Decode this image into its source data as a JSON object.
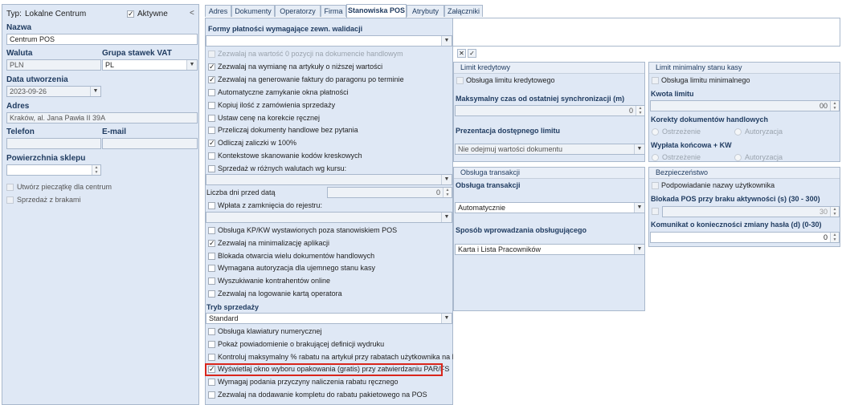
{
  "left": {
    "type_label": "Typ:",
    "type_value": "Lokalne Centrum",
    "active_label": "Aktywne",
    "active_checked": true,
    "collapse": "<",
    "name_label": "Nazwa",
    "name_value": "Centrum POS",
    "currency_label": "Waluta",
    "currency_value": "PLN",
    "vat_label": "Grupa stawek VAT",
    "vat_value": "PL",
    "created_label": "Data utworzenia",
    "created_value": "2023-09-26",
    "address_label": "Adres",
    "address_value": "Kraków, al. Jana Pawła II 39A",
    "phone_label": "Telefon",
    "email_label": "E-mail",
    "area_label": "Powierzchnia sklepu",
    "stamp_label": "Utwórz pieczątkę dla centrum",
    "barcode_label": "Sprzedaż z brakami"
  },
  "tabs": [
    "Adres",
    "Dokumenty",
    "Operatorzy",
    "Firma",
    "Stanowiska POS",
    "Atrybuty",
    "Załączniki"
  ],
  "active_tab": "Stanowiska POS",
  "mid": {
    "payment_title": "Formy płatności wymagające zewn. walidacji",
    "options_a": [
      {
        "label": "Zezwalaj na wartość 0 pozycji na dokumencie handlowym",
        "checked": false,
        "disabled": true
      },
      {
        "label": "Zezwalaj na wymianę na artykuły o niższej wartości",
        "checked": true,
        "disabled": false
      },
      {
        "label": "Zezwalaj na generowanie faktury do paragonu po terminie",
        "checked": true,
        "disabled": false
      },
      {
        "label": "Automatyczne zamykanie okna płatności",
        "checked": false,
        "disabled": false
      },
      {
        "label": "Kopiuj ilość z zamówienia sprzedaży",
        "checked": false,
        "disabled": false
      },
      {
        "label": "Ustaw cenę na korekcie ręcznej",
        "checked": false,
        "disabled": false
      },
      {
        "label": "Przeliczaj dokumenty handlowe bez pytania",
        "checked": false,
        "disabled": false
      },
      {
        "label": "Odliczaj zaliczki w 100%",
        "checked": true,
        "disabled": false
      },
      {
        "label": "Kontekstowe skanowanie kodów kreskowych",
        "checked": false,
        "disabled": false
      },
      {
        "label": "Sprzedaż w różnych walutach wg kursu:",
        "checked": false,
        "disabled": false
      }
    ],
    "days_label": "Liczba dni przed datą",
    "days_value": "0",
    "deposit_label": "Wpłata z zamknięcia do rejestru:",
    "options_b": [
      {
        "label": "Obsługa KP/KW wystawionych poza stanowiskiem POS",
        "checked": false
      },
      {
        "label": "Zezwalaj na minimalizację aplikacji",
        "checked": true
      },
      {
        "label": "Blokada otwarcia wielu dokumentów handlowych",
        "checked": false
      },
      {
        "label": "Wymagana autoryzacja dla ujemnego stanu kasy",
        "checked": false
      },
      {
        "label": "Wyszukiwanie kontrahentów online",
        "checked": false
      },
      {
        "label": "Zezwalaj na logowanie kartą operatora",
        "checked": false
      }
    ],
    "sale_mode_label": "Tryb sprzedaży",
    "sale_mode_value": "Standard",
    "options_c": [
      {
        "label": "Obsługa klawiatury numerycznej",
        "checked": false
      },
      {
        "label": "Pokaż powiadomienie o brakującej definicji wydruku",
        "checked": false
      },
      {
        "label": "Kontroluj maksymalny % rabatu na artykuł przy rabatach użytkownika na POS",
        "checked": false
      },
      {
        "label": "Wyświetlaj okno wyboru opakowania (gratis) przy zatwierdzaniu PAR/FS",
        "checked": true
      },
      {
        "label": "Wymagaj podania przyczyny naliczenia rabatu ręcznego",
        "checked": false
      },
      {
        "label": "Zezwalaj na dodawanie kompletu do rabatu pakietowego na POS",
        "checked": false
      }
    ]
  },
  "right": {
    "clear_btn": "✕",
    "ok_btn": "✓",
    "credit": {
      "title": "Limit kredytowy",
      "handle_label": "Obsługa limitu kredytowego",
      "maxtime_label": "Maksymalny czas od ostatniej synchronizacji (m)",
      "maxtime_value": "0",
      "presentation_label": "Prezentacja dostępnego limitu",
      "presentation_value": "Nie odejmuj wartości dokumentu"
    },
    "minstock": {
      "title": "Limit minimalny stanu kasy",
      "handle_label": "Obsługa limitu minimalnego",
      "amount_label": "Kwota limitu",
      "amount_value": "00",
      "corrections_label": "Korekty dokumentów handlowych",
      "warn": "Ostrzeżenie",
      "auth": "Autoryzacja",
      "payout_label": "Wypłata końcowa + KW"
    },
    "trans": {
      "title": "Obsługa transakcji",
      "label": "Obsługa transakcji",
      "value": "Automatycznie",
      "input_label": "Sposób wprowadzania obsługującego",
      "input_value": "Karta i Lista Pracowników"
    },
    "security": {
      "title": "Bezpieczeństwo",
      "hint_label": "Podpowiadanie nazwy użytkownika",
      "block_label": "Blokada POS przy braku aktywności (s) (30 - 300)",
      "block_value": "30",
      "pwd_label": "Komunikat o konieczności zmiany hasła (d) (0-30)",
      "pwd_value": "0"
    }
  },
  "colors": {
    "highlight": "#d9261c",
    "panel": "#dfe8f5",
    "border": "#a9b8cc"
  }
}
